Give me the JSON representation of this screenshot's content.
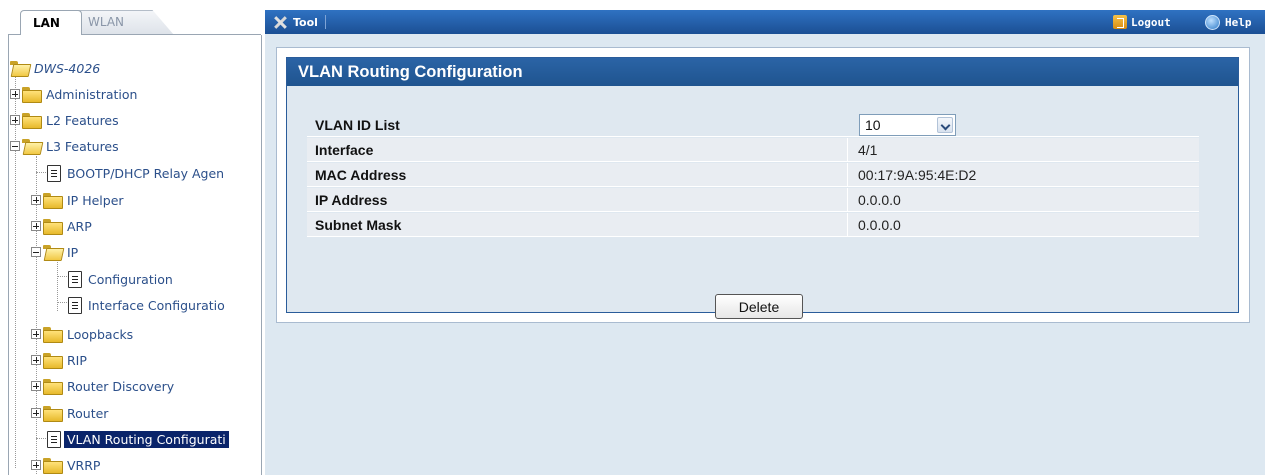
{
  "tabs": [
    {
      "label": "LAN",
      "active": true
    },
    {
      "label": "WLAN",
      "active": false
    }
  ],
  "toolbar": {
    "tool_label": "Tool",
    "logout_label": "Logout",
    "help_label": "Help"
  },
  "tree": {
    "root": "DWS-4026",
    "items": [
      {
        "label": "Administration",
        "type": "folder"
      },
      {
        "label": "L2 Features",
        "type": "folder"
      },
      {
        "label": "L3 Features",
        "type": "folder-open"
      },
      {
        "label": "BOOTP/DHCP Relay Agen",
        "type": "page"
      },
      {
        "label": "IP Helper",
        "type": "folder"
      },
      {
        "label": "ARP",
        "type": "folder"
      },
      {
        "label": "IP",
        "type": "folder-open"
      },
      {
        "label": "Configuration",
        "type": "page"
      },
      {
        "label": "Interface Configuratio",
        "type": "page"
      },
      {
        "label": "Loopbacks",
        "type": "folder"
      },
      {
        "label": "RIP",
        "type": "folder"
      },
      {
        "label": "Router Discovery",
        "type": "folder"
      },
      {
        "label": "Router",
        "type": "folder"
      },
      {
        "label": "VLAN Routing Configurati",
        "type": "page",
        "selected": true
      },
      {
        "label": "VRRP",
        "type": "folder"
      }
    ]
  },
  "panel": {
    "title": "VLAN Routing Configuration",
    "rows": [
      {
        "label": "VLAN ID List",
        "value": "10"
      },
      {
        "label": "Interface",
        "value": "4/1"
      },
      {
        "label": "MAC Address",
        "value": "00:17:9A:95:4E:D2"
      },
      {
        "label": "IP Address",
        "value": "0.0.0.0"
      },
      {
        "label": "Subnet Mask",
        "value": "0.0.0.0"
      }
    ],
    "delete_label": "Delete"
  },
  "colors": {
    "toolbar": "#1b4f94",
    "panel_header": "#2b64a6",
    "selection": "#0a246a",
    "main_bg": "#dde8f1"
  }
}
